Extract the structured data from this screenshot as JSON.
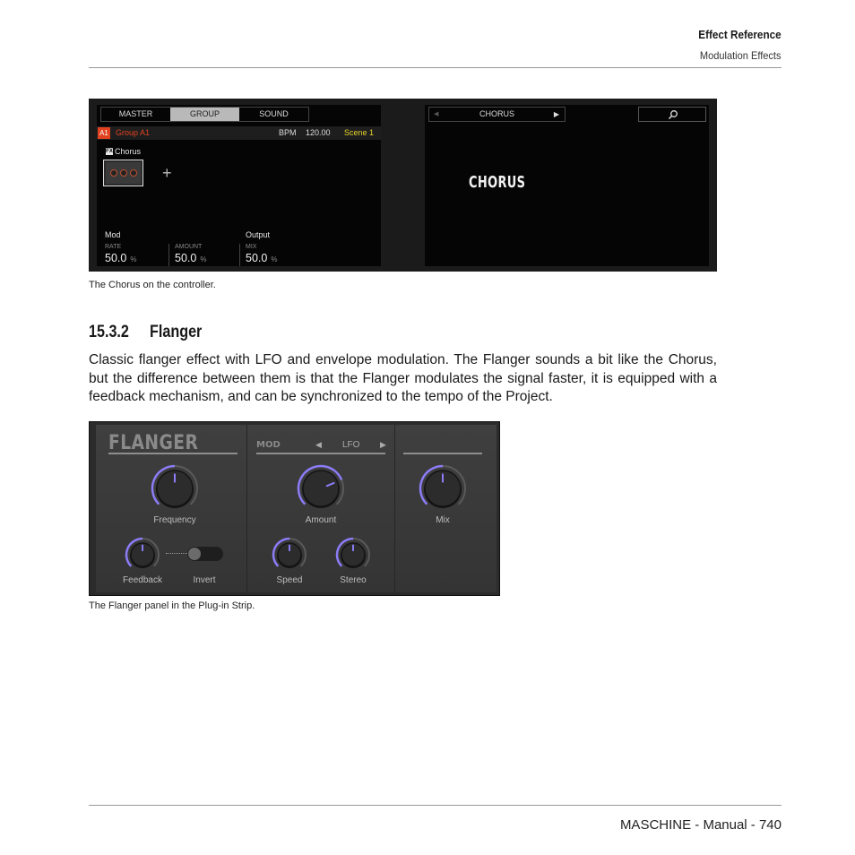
{
  "header": {
    "chapter": "Effect Reference",
    "section": "Modulation Effects"
  },
  "controller": {
    "tabs": [
      {
        "label": "MASTER",
        "active": false
      },
      {
        "label": "GROUP",
        "active": true
      },
      {
        "label": "SOUND",
        "active": false
      }
    ],
    "group_id": "A1",
    "group_name": "Group A1",
    "bpm_label": "BPM",
    "bpm_value": "120.00",
    "scene": "Scene 1",
    "fx_icon": "FX",
    "plugin_name": "Chorus",
    "add_icon": "+",
    "section_mod": "Mod",
    "section_output": "Output",
    "params": [
      {
        "label": "RATE",
        "value": "50.0",
        "unit": "%"
      },
      {
        "label": "AMOUNT",
        "value": "50.0",
        "unit": "%"
      },
      {
        "label": "MIX",
        "value": "50.0",
        "unit": "%"
      }
    ],
    "nav_prev": "◀",
    "nav_name": "CHORUS",
    "nav_next": "▶",
    "big_title": "CHORUS"
  },
  "caption1": "The Chorus on the controller.",
  "section": {
    "number": "15.3.2",
    "title": "Flanger",
    "body": "Classic flanger effect with LFO and envelope modulation. The Flanger sounds a bit like the Chorus, but the difference between them is that the Flanger modulates the signal faster, it is equipped with a feedback mechanism, and can be synchronized to the tempo of the Project."
  },
  "flanger": {
    "title": "FLANGER",
    "mod_label": "MOD",
    "mod_prev": "◀",
    "mod_value": "LFO",
    "mod_next": "▶",
    "accent": "#8b7cf6",
    "knobs": {
      "frequency": {
        "label": "Frequency",
        "value": 0.5
      },
      "feedback": {
        "label": "Feedback",
        "value": 0.5
      },
      "amount": {
        "label": "Amount",
        "value": 0.75
      },
      "speed": {
        "label": "Speed",
        "value": 0.5
      },
      "stereo": {
        "label": "Stereo",
        "value": 0.5
      },
      "mix": {
        "label": "Mix",
        "value": 0.5
      }
    },
    "invert_label": "Invert",
    "invert_on": false
  },
  "caption2": "The Flanger panel in the Plug-in Strip.",
  "footer": "MASCHINE - Manual - 740"
}
